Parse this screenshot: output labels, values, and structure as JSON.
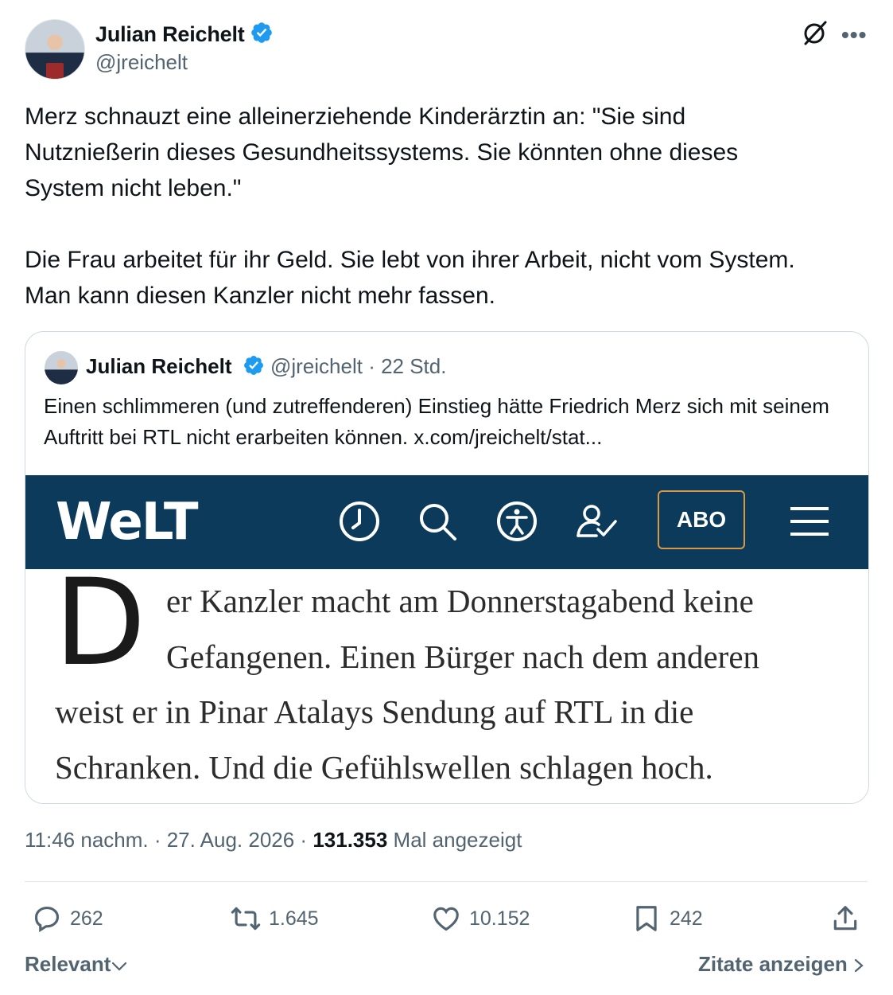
{
  "author": {
    "name": "Julian Reichelt",
    "handle": "@jreichelt"
  },
  "tweet": {
    "text": "Merz schnauzt eine alleinerziehende Kinderärztin an: \"Sie sind\nNutznießerin dieses Gesundheitssystems. Sie könnten ohne dieses\nSystem nicht leben.\"\n\nDie Frau arbeitet für ihr Geld. Sie lebt von ihrer Arbeit, nicht vom System.\nMan kann diesen Kanzler nicht mehr fassen."
  },
  "quote": {
    "name": "Julian Reichelt",
    "handle": "@jreichelt",
    "time": "· 22 Std.",
    "text": "Einen schlimmeren (und zutreffenderen) Einstieg hätte Friedrich Merz sich mit seinem Auftritt bei RTL nicht erarbeiten können.  x.com/jreichelt/stat..."
  },
  "welt": {
    "logo": "WeLT",
    "abo_label": "ABO",
    "bar_color": "#0b3a5b",
    "abo_border_color": "#d89845"
  },
  "article": {
    "dropcap": "D",
    "lines": [
      "er Kanzler macht am Donnerstagabend keine",
      "Gefangenen. Einen Bürger nach dem anderen",
      "weist er in Pinar Atalays Sendung auf RTL in die",
      "Schranken. Und die Gefühlswellen schlagen hoch."
    ]
  },
  "meta": {
    "time": "11:46 nachm. · 27. Aug. 2026 ·",
    "views": "131.353",
    "views_label": "Mal angezeigt"
  },
  "actions": {
    "replies": "262",
    "reposts": "1.645",
    "likes": "10.152",
    "bookmarks": "242"
  },
  "footer": {
    "sort_label": "Relevant",
    "quotes_label": "Zitate anzeigen"
  },
  "colors": {
    "verified": "#1d9bf0",
    "secondary_text": "#536471"
  }
}
